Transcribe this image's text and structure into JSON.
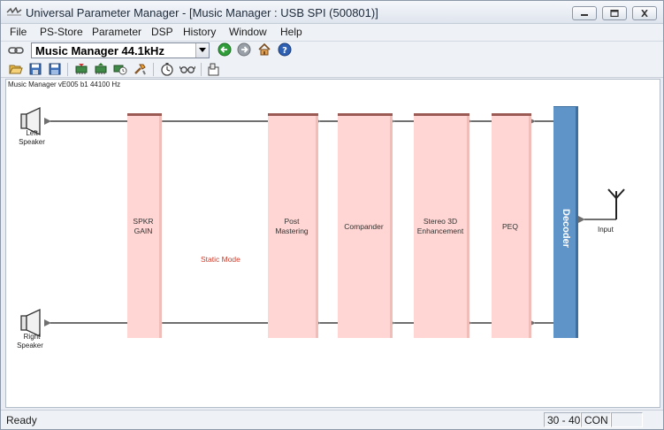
{
  "window": {
    "title": "Universal Parameter Manager - [Music Manager : USB SPI (500801)]"
  },
  "menu": {
    "items": [
      "File",
      "PS-Store",
      "Parameter",
      "DSP",
      "History",
      "Window",
      "Help"
    ]
  },
  "toolbar": {
    "preset_value": "Music Manager 44.1kHz",
    "icons": [
      "link-icon",
      "back-icon",
      "forward-icon",
      "home-icon",
      "help-icon",
      "open-icon",
      "save-icon",
      "save-all-icon",
      "chip-read-icon",
      "chip-write-icon",
      "chip-info-icon",
      "tools-icon",
      "timer-icon",
      "glasses-icon",
      "export-icon"
    ]
  },
  "canvas": {
    "header": "Music Manager vE005 b1 44100 Hz",
    "static_mode": "Static Mode",
    "blocks": {
      "spkr_gain": [
        "SPKR",
        "GAIN"
      ],
      "post_mastering": [
        "Post",
        "Mastering"
      ],
      "compander": [
        "Compander"
      ],
      "stereo3d": [
        "Stereo 3D",
        "Enhancement"
      ],
      "peq": [
        "PEQ"
      ]
    },
    "decoder": "Decoder",
    "left_speaker": [
      "Left",
      "Speaker"
    ],
    "right_speaker": [
      "Right",
      "Speaker"
    ],
    "input": "Input"
  },
  "status": {
    "text": "Ready",
    "position": "30 - 40",
    "mode": "CON",
    "extra": ""
  },
  "colors": {
    "block_fill": "#ffd6d3",
    "block_top": "#9c5a55",
    "decoder_fill": "#5f94c8",
    "wire": "#6f6f6f",
    "static_mode_text": "#d13c2a"
  }
}
